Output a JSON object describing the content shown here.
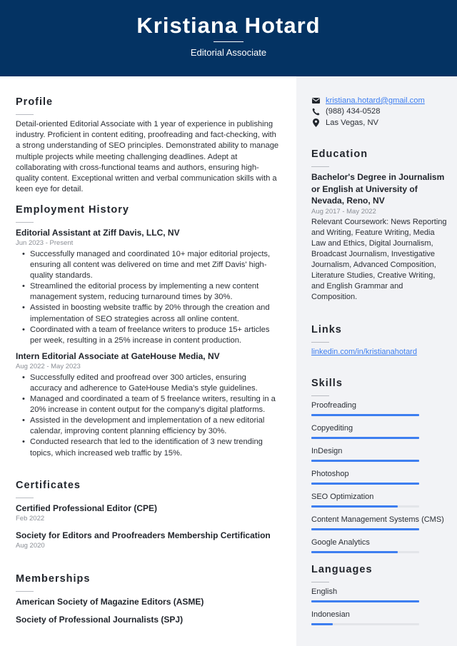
{
  "header": {
    "name": "Kristiana Hotard",
    "title": "Editorial Associate",
    "background": "#043363"
  },
  "profile": {
    "heading": "Profile",
    "text": "Detail-oriented Editorial Associate with 1 year of experience in publishing industry. Proficient in content editing, proofreading and fact-checking, with a strong understanding of SEO principles. Demonstrated ability to manage multiple projects while meeting challenging deadlines. Adept at collaborating with cross-functional teams and authors, ensuring high-quality content. Exceptional written and verbal communication skills with a keen eye for detail."
  },
  "employment": {
    "heading": "Employment History",
    "jobs": [
      {
        "title": "Editorial Assistant at Ziff Davis, LLC, NV",
        "dates": "Jun 2023 - Present",
        "bullets": [
          "Successfully managed and coordinated 10+ major editorial projects, ensuring all content was delivered on time and met Ziff Davis' high-quality standards.",
          "Streamlined the editorial process by implementing a new content management system, reducing turnaround times by 30%.",
          "Assisted in boosting website traffic by 20% through the creation and implementation of SEO strategies across all online content.",
          "Coordinated with a team of freelance writers to produce 15+ articles per week, resulting in a 25% increase in content production."
        ]
      },
      {
        "title": "Intern Editorial Associate at GateHouse Media, NV",
        "dates": "Aug 2022 - May 2023",
        "bullets": [
          "Successfully edited and proofread over 300 articles, ensuring accuracy and adherence to GateHouse Media's style guidelines.",
          "Managed and coordinated a team of 5 freelance writers, resulting in a 20% increase in content output for the company's digital platforms.",
          "Assisted in the development and implementation of a new editorial calendar, improving content planning efficiency by 30%.",
          "Conducted research that led to the identification of 3 new trending topics, which increased web traffic by 15%."
        ]
      }
    ]
  },
  "certificates": {
    "heading": "Certificates",
    "items": [
      {
        "title": "Certified Professional Editor (CPE)",
        "date": "Feb 2022"
      },
      {
        "title": "Society for Editors and Proofreaders Membership Certification",
        "date": "Aug 2020"
      }
    ]
  },
  "memberships": {
    "heading": "Memberships",
    "items": [
      "American Society of Magazine Editors (ASME)",
      "Society of Professional Journalists (SPJ)"
    ]
  },
  "contact": {
    "email": "kristiana.hotard@gmail.com",
    "phone": "(988) 434-0528",
    "location": "Las Vegas, NV",
    "email_icon": "envelope-icon",
    "phone_icon": "phone-icon",
    "location_icon": "map-pin-icon"
  },
  "education": {
    "heading": "Education",
    "degree": "Bachelor's Degree in Journalism or English at University of Nevada, Reno, NV",
    "dates": "Aug 2017 - May 2022",
    "description": "Relevant Coursework: News Reporting and Writing, Feature Writing, Media Law and Ethics, Digital Journalism, Broadcast Journalism, Investigative Journalism, Advanced Composition, Literature Studies, Creative Writing, and English Grammar and Composition."
  },
  "links": {
    "heading": "Links",
    "items": [
      "linkedin.com/in/kristianahotard"
    ]
  },
  "skills": {
    "heading": "Skills",
    "items": [
      {
        "name": "Proofreading",
        "level": 1.0
      },
      {
        "name": "Copyediting",
        "level": 1.0
      },
      {
        "name": "InDesign",
        "level": 1.0
      },
      {
        "name": "Photoshop",
        "level": 1.0
      },
      {
        "name": "SEO Optimization",
        "level": 0.8
      },
      {
        "name": "Content Management Systems (CMS)",
        "level": 1.0
      },
      {
        "name": "Google Analytics",
        "level": 0.8
      }
    ]
  },
  "languages": {
    "heading": "Languages",
    "items": [
      {
        "name": "English",
        "level": 1.0
      },
      {
        "name": "Indonesian",
        "level": 0.2
      }
    ]
  },
  "colors": {
    "accent": "#3d7ef0",
    "header_bg": "#043363",
    "sidebar_bg": "#f2f3f6"
  }
}
